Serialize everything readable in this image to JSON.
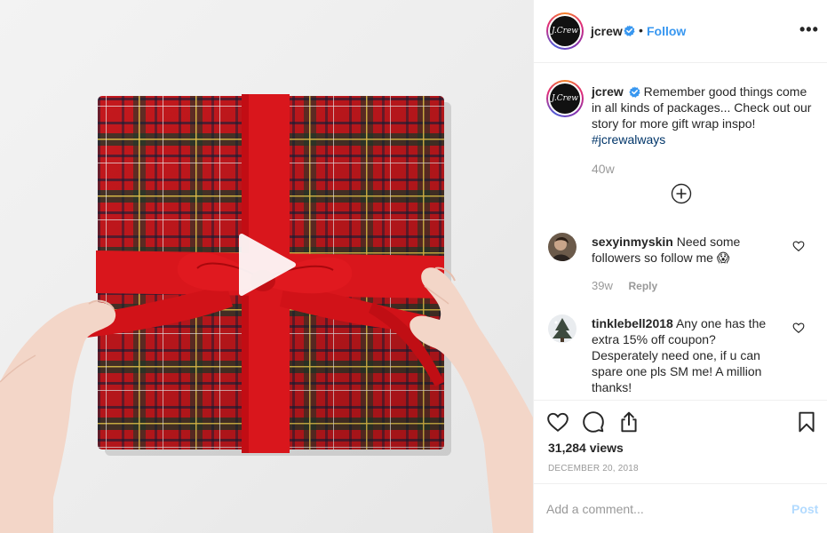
{
  "post": {
    "username": "jcrew",
    "avatar_logo_text": "J.Crew",
    "follow_label": "Follow",
    "separator": "•",
    "more_label": "•••"
  },
  "caption": {
    "username": "jcrew",
    "text": "Remember good things come in all kinds of packages... Check out our story for more gift wrap inspo!",
    "hashtag": "#jcrewalways",
    "time": "40w"
  },
  "comments": [
    {
      "username": "sexyinmyskin",
      "text": "Need some followers so follow me 😱",
      "time": "39w",
      "reply_label": "Reply"
    },
    {
      "username": "tinklebell2018",
      "text": "Any one has the extra 15% off coupon? Desperately need one, if u can spare one pls SM me! A million thanks!"
    }
  ],
  "stats": {
    "views": "31,284 views",
    "date": "DECEMBER 20, 2018"
  },
  "composer": {
    "placeholder": "Add a comment...",
    "post_label": "Post"
  },
  "icons": {
    "verified": "verified-badge-icon",
    "like": "heart-icon",
    "comment": "comment-icon",
    "share": "share-icon",
    "save": "bookmark-icon",
    "load_more": "plus-circle-icon",
    "play": "play-icon"
  },
  "colors": {
    "accent": "#3897f0",
    "hashtag": "#003569",
    "muted": "#999999",
    "post_disabled": "#b3dbff",
    "ribbon": "#d9161c",
    "plaid": "#c4181d"
  }
}
